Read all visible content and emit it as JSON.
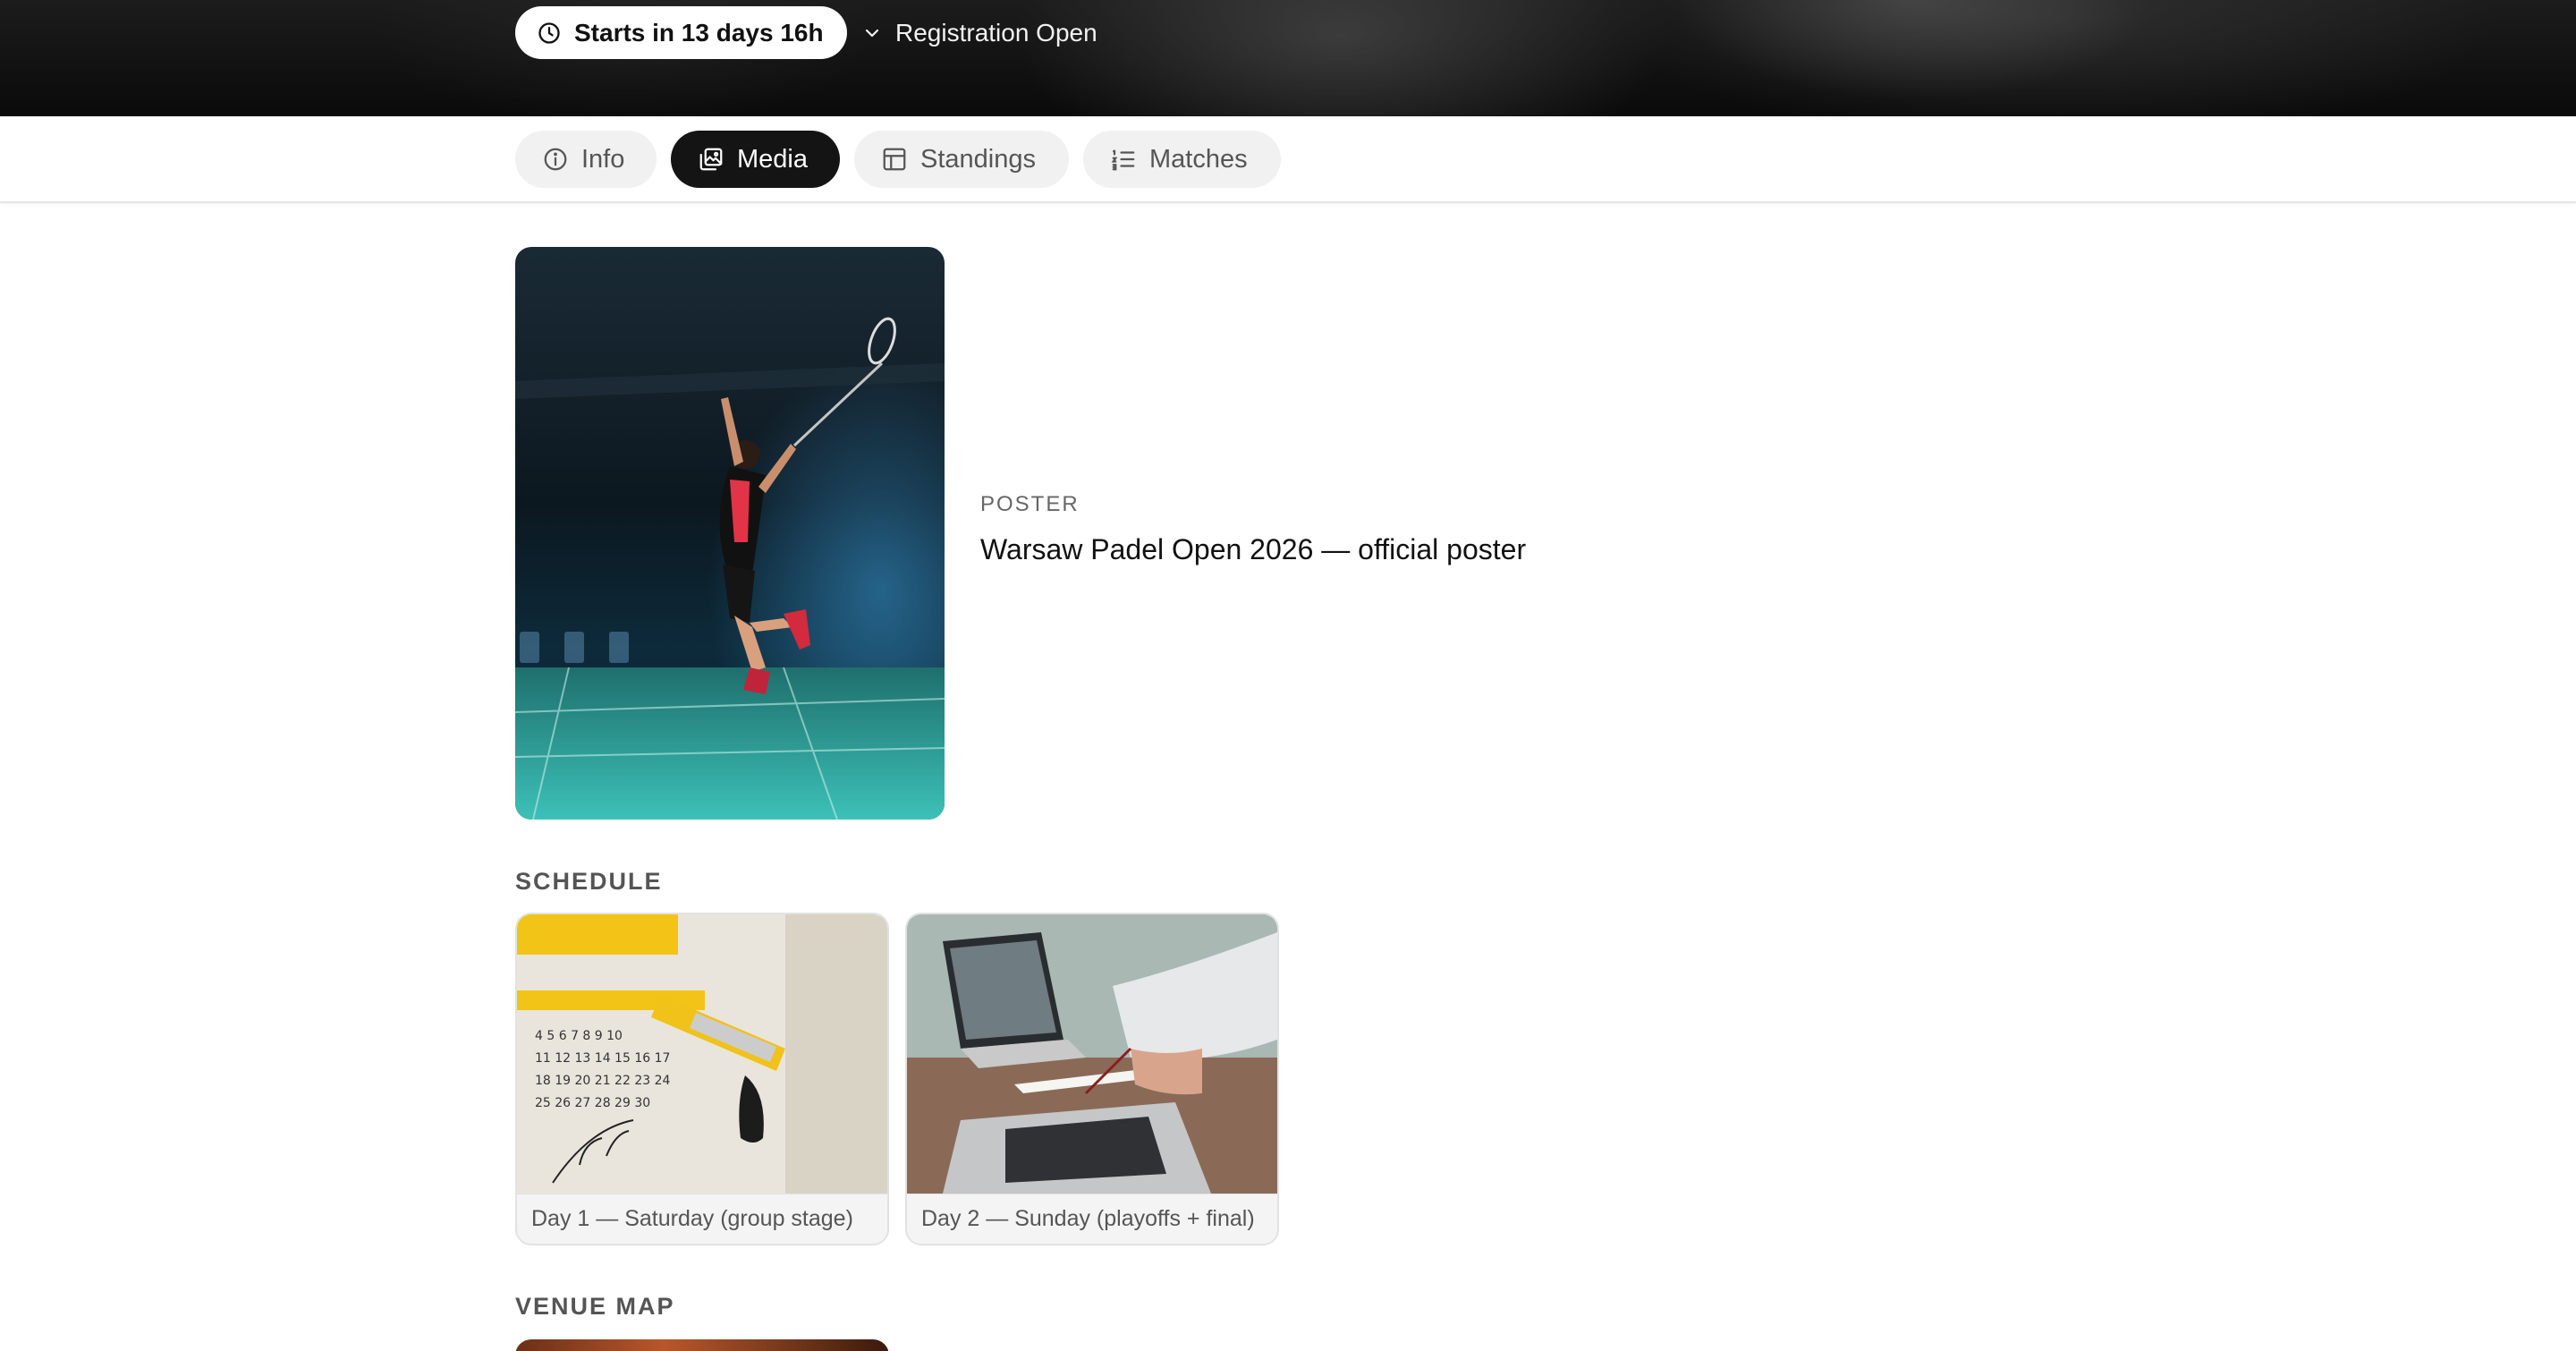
{
  "hero": {
    "countdown": "Starts in 13 days 16h",
    "registration": "Registration Open"
  },
  "tabs": [
    {
      "label": "Info",
      "icon": "info-icon",
      "active": false
    },
    {
      "label": "Media",
      "icon": "gallery-icon",
      "active": true
    },
    {
      "label": "Standings",
      "icon": "table-icon",
      "active": false
    },
    {
      "label": "Matches",
      "icon": "list-icon",
      "active": false
    }
  ],
  "poster": {
    "kicker": "POSTER",
    "title": "Warsaw Padel Open 2026 — official poster"
  },
  "schedule": {
    "heading": "SCHEDULE",
    "items": [
      {
        "caption": "Day 1 — Saturday (group stage)"
      },
      {
        "caption": "Day 2 — Sunday (playoffs + final)"
      }
    ]
  },
  "venue": {
    "heading": "VENUE MAP"
  },
  "colors": {
    "accent": "#141414",
    "tab_bg": "#f1f1f1",
    "court": "#2aa8a0"
  }
}
